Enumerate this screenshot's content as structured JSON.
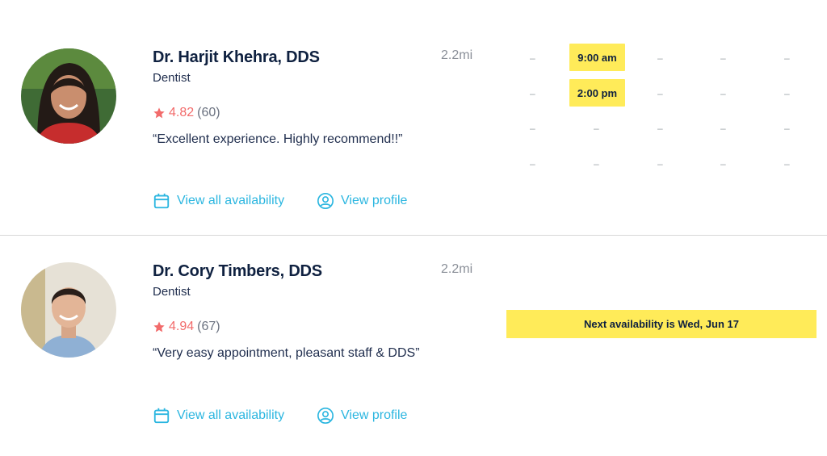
{
  "providers": [
    {
      "name": "Dr. Harjit Khehra, DDS",
      "specialty": "Dentist",
      "rating": "4.82",
      "review_count": "(60)",
      "review": "“Excellent experience. Highly recommend!!”",
      "distance": "2.2mi",
      "links": {
        "availability": "View all availability",
        "profile": "View profile"
      },
      "slots": [
        "9:00 am",
        "2:00 pm"
      ],
      "empty_slot": "–"
    },
    {
      "name": "Dr. Cory Timbers, DDS",
      "specialty": "Dentist",
      "rating": "4.94",
      "review_count": "(67)",
      "review": "“Very easy appointment, pleasant staff & DDS”",
      "distance": "2.2mi",
      "links": {
        "availability": "View all availability",
        "profile": "View profile"
      },
      "next_availability": "Next availability is Wed, Jun 17"
    }
  ],
  "colors": {
    "accent": "#2bb6e0",
    "star": "#f26b6b",
    "slot": "#ffeb59",
    "name": "#0f2140"
  },
  "icons": {
    "rating": "star-icon",
    "availability": "calendar-icon",
    "profile": "user-circle-icon"
  }
}
